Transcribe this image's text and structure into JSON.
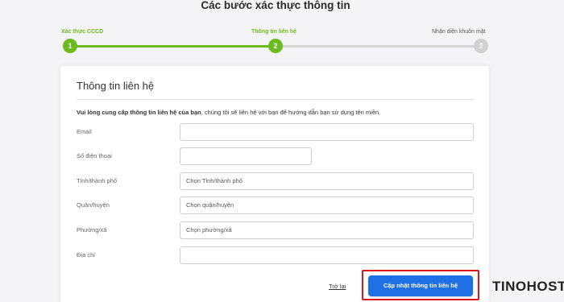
{
  "page": {
    "title": "Các bước xác thực thông tin"
  },
  "stepper": {
    "steps": [
      {
        "label": "Xác thực CCCD",
        "number": "1",
        "state": "done"
      },
      {
        "label": "Thông tin liên hệ",
        "number": "2",
        "state": "done"
      },
      {
        "label": "Nhận diện khuôn mặt",
        "number": "3",
        "state": "todo"
      }
    ]
  },
  "form": {
    "title": "Thông tin liên hệ",
    "intro_bold": "Vui lòng cung cấp thông tin liên hệ của bạn",
    "intro_rest": ", chúng tôi sẽ liên hệ với bạn để hướng dẫn bạn sử dụng tên miền.",
    "fields": [
      {
        "label": "Email",
        "value": "",
        "type": "input"
      },
      {
        "label": "Số điện thoại",
        "value": "",
        "type": "input"
      },
      {
        "label": "Tỉnh/thành phố",
        "value": "Chọn Tỉnh/thành phố",
        "type": "select"
      },
      {
        "label": "Quận/huyện",
        "value": "Chọn quận/huyện",
        "type": "select"
      },
      {
        "label": "Phường/xã",
        "value": "Chọn phường/xã",
        "type": "select"
      },
      {
        "label": "Địa chỉ",
        "value": "",
        "type": "input"
      }
    ],
    "back_label": "Trở lại",
    "submit_label": "Cập nhật thông tin liên hệ"
  },
  "brand": {
    "logo_text": "TINOHOST"
  },
  "colors": {
    "accent_green": "#6cbb1e",
    "primary_blue": "#1f6fe5",
    "highlight_red": "#e0141c"
  }
}
